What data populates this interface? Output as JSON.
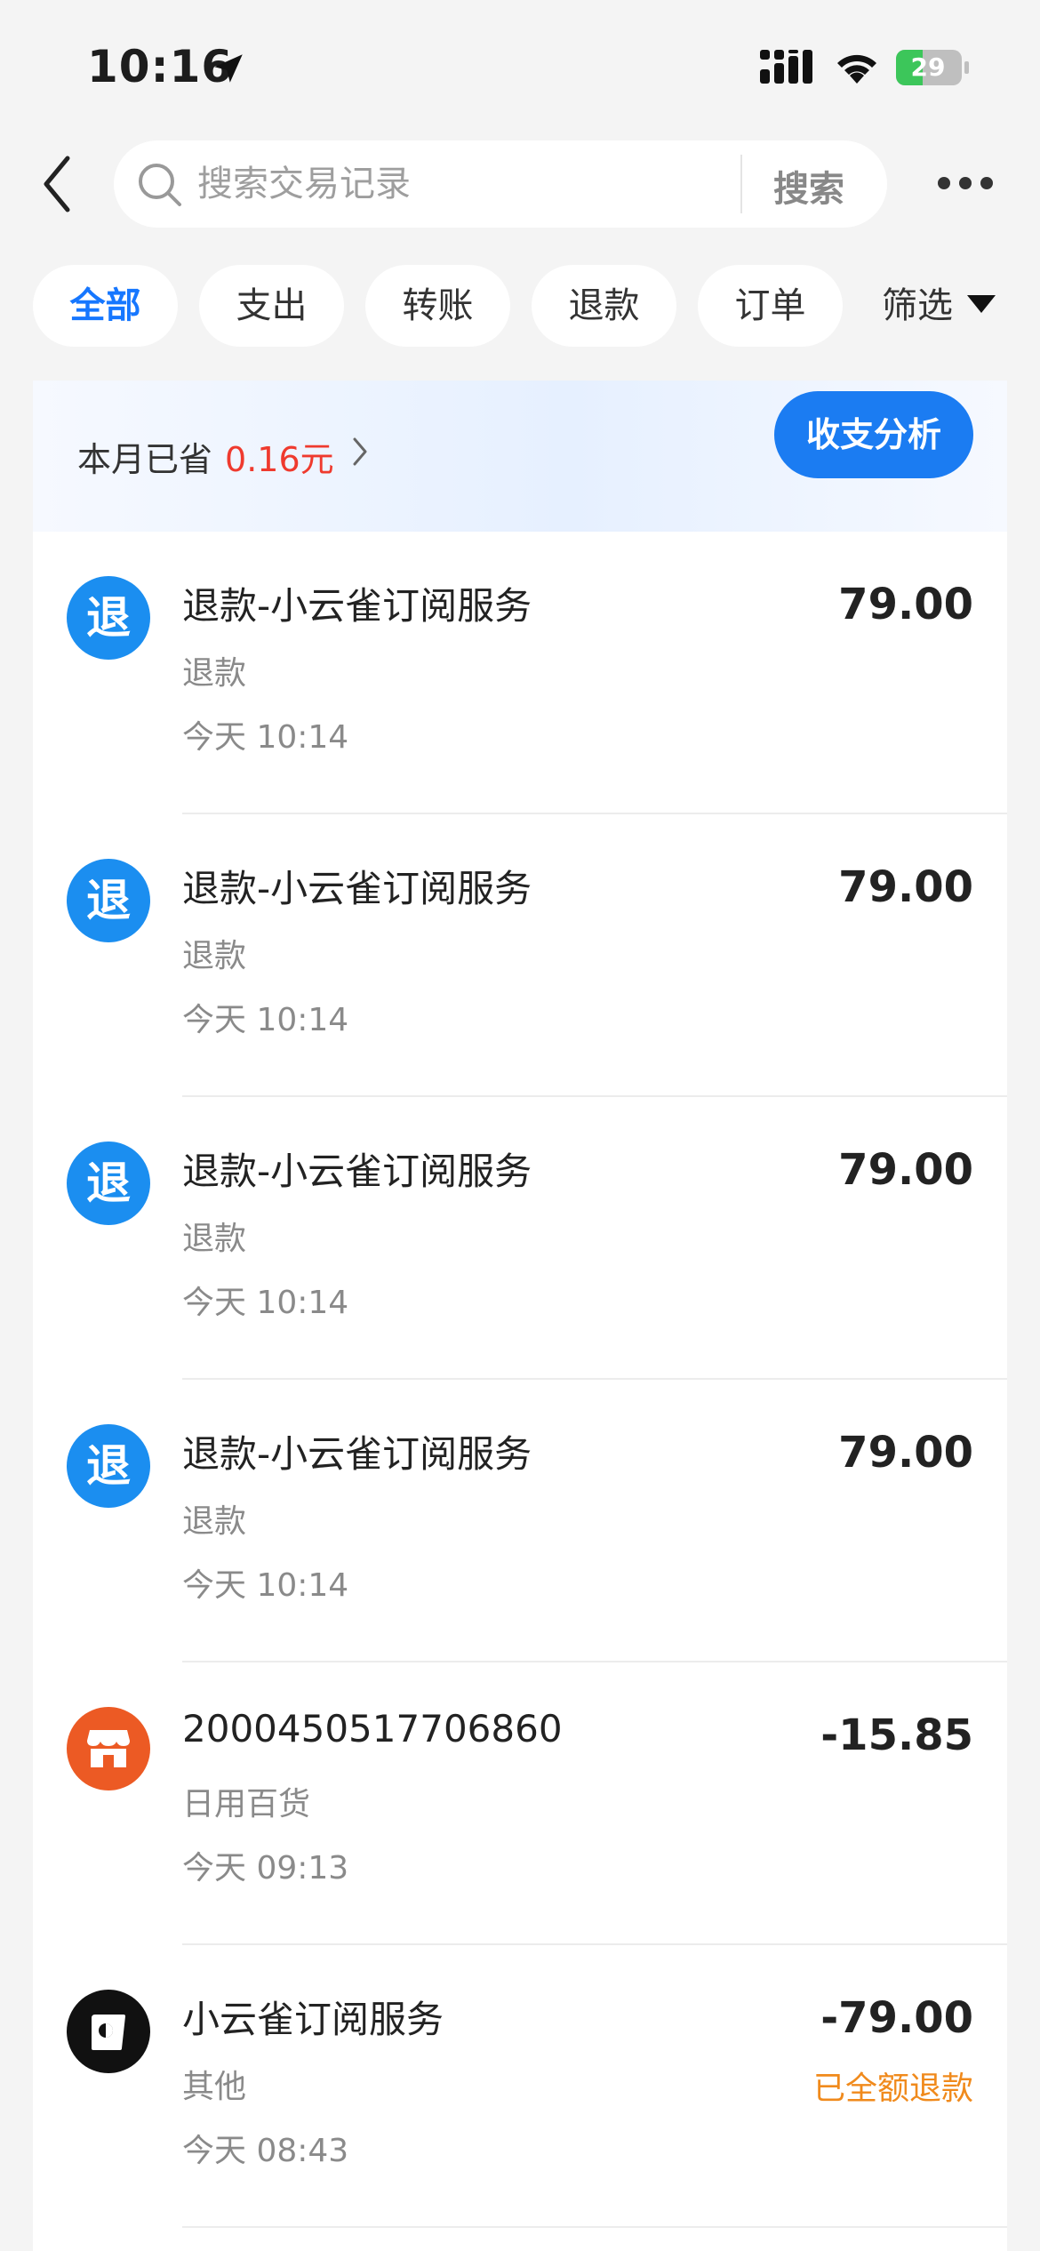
{
  "status_bar": {
    "time": "10:16",
    "battery": "29"
  },
  "search": {
    "placeholder": "搜索交易记录",
    "button": "搜索"
  },
  "filters": {
    "chips": [
      "全部",
      "支出",
      "转账",
      "退款",
      "订单"
    ],
    "active": "全部",
    "filter_label": "筛选"
  },
  "summary": {
    "label": "本月已省",
    "value": "0.16元",
    "analysis_button": "收支分析"
  },
  "transactions": [
    {
      "icon": "refund-icon",
      "icon_text": "退",
      "title": "退款-小云雀订阅服务",
      "category": "退款",
      "time": "今天 10:14",
      "amount": "79.00"
    },
    {
      "icon": "refund-icon",
      "icon_text": "退",
      "title": "退款-小云雀订阅服务",
      "category": "退款",
      "time": "今天 10:14",
      "amount": "79.00"
    },
    {
      "icon": "refund-icon",
      "icon_text": "退",
      "title": "退款-小云雀订阅服务",
      "category": "退款",
      "time": "今天 10:14",
      "amount": "79.00"
    },
    {
      "icon": "refund-icon",
      "icon_text": "退",
      "title": "退款-小云雀订阅服务",
      "category": "退款",
      "time": "今天 10:14",
      "amount": "79.00"
    },
    {
      "icon": "store-icon",
      "title": "2000450517706860",
      "category": "日用百货",
      "time": "今天 09:13",
      "amount": "-15.85"
    },
    {
      "icon": "app-logo-icon",
      "title": "小云雀订阅服务",
      "category": "其他",
      "time": "今天 08:43",
      "amount": "-79.00",
      "status": "已全额退款"
    }
  ]
}
